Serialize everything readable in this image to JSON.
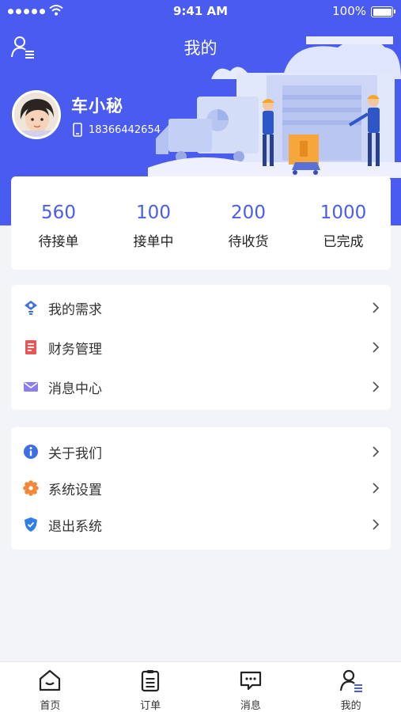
{
  "status_bar": {
    "time": "9:41 AM",
    "battery": "100%"
  },
  "header": {
    "title": "我的"
  },
  "user": {
    "name": "车小秘",
    "phone": "18366442654"
  },
  "stats": [
    {
      "value": "560",
      "label": "待接单"
    },
    {
      "value": "100",
      "label": "接单中"
    },
    {
      "value": "200",
      "label": "待收货"
    },
    {
      "value": "1000",
      "label": "已完成"
    }
  ],
  "menu_group_1": [
    {
      "label": "我的需求",
      "icon": "lightbulb-icon",
      "color": "#3f6fe0"
    },
    {
      "label": "财务管理",
      "icon": "ledger-icon",
      "color": "#e85656"
    },
    {
      "label": "消息中心",
      "icon": "mail-icon",
      "color": "#8b7cf0"
    }
  ],
  "menu_group_2": [
    {
      "label": "关于我们",
      "icon": "info-icon",
      "color": "#3f6fe0"
    },
    {
      "label": "系统设置",
      "icon": "gear-icon",
      "color": "#f0883a"
    },
    {
      "label": "退出系统",
      "icon": "shield-icon",
      "color": "#2f7de8"
    }
  ],
  "tabbar": [
    {
      "label": "首页",
      "icon": "home-icon"
    },
    {
      "label": "订单",
      "icon": "clipboard-icon"
    },
    {
      "label": "消息",
      "icon": "chat-icon"
    },
    {
      "label": "我的",
      "icon": "user-icon"
    }
  ],
  "colors": {
    "primary": "#4a5cf0",
    "background": "#f3f4f8"
  }
}
